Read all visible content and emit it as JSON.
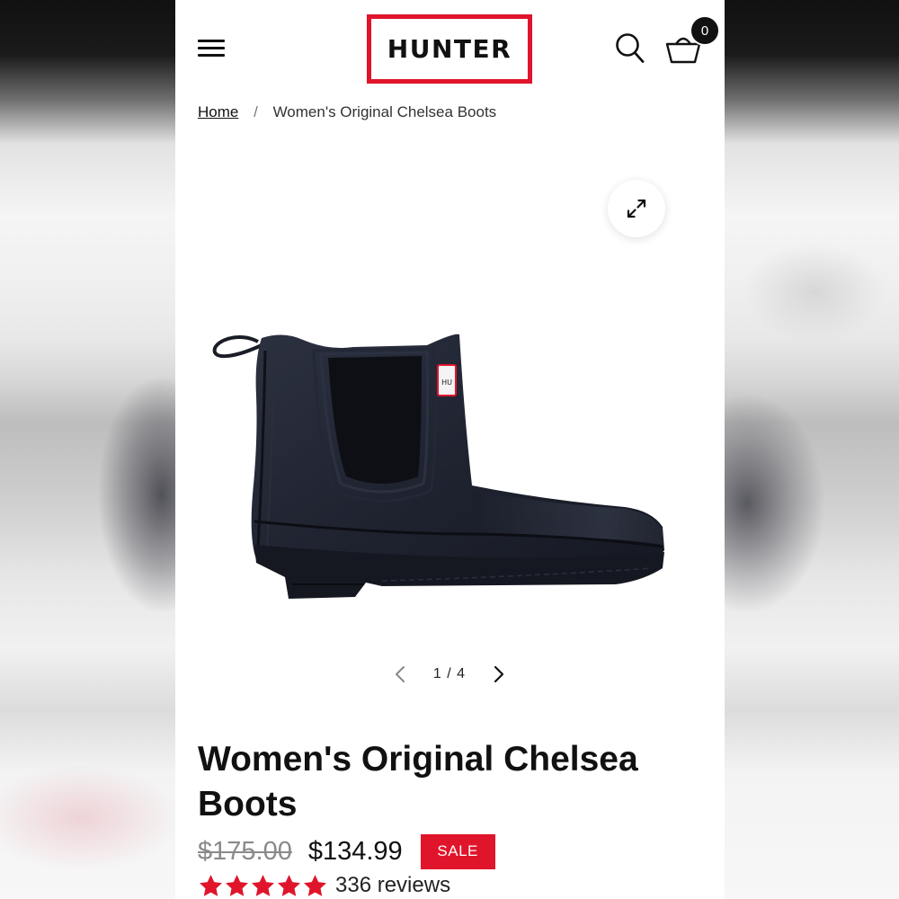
{
  "header": {
    "brand": "HUNTER",
    "cart_count": "0",
    "brand_color": "#e0152b"
  },
  "breadcrumb": {
    "home": "Home",
    "current": "Women's Original Chelsea Boots"
  },
  "gallery": {
    "current": "1",
    "separator": "/",
    "total": "4",
    "image_alt": "Navy Women's Original Chelsea Boot"
  },
  "product": {
    "title": "Women's Original Chelsea Boots",
    "price_original": "$175.00",
    "price_sale": "$134.99",
    "sale_badge": "SALE",
    "rating": 5,
    "reviews": "336 reviews"
  },
  "colors": {
    "accent": "#e0152b",
    "text": "#111111",
    "star": "#e0152b"
  }
}
